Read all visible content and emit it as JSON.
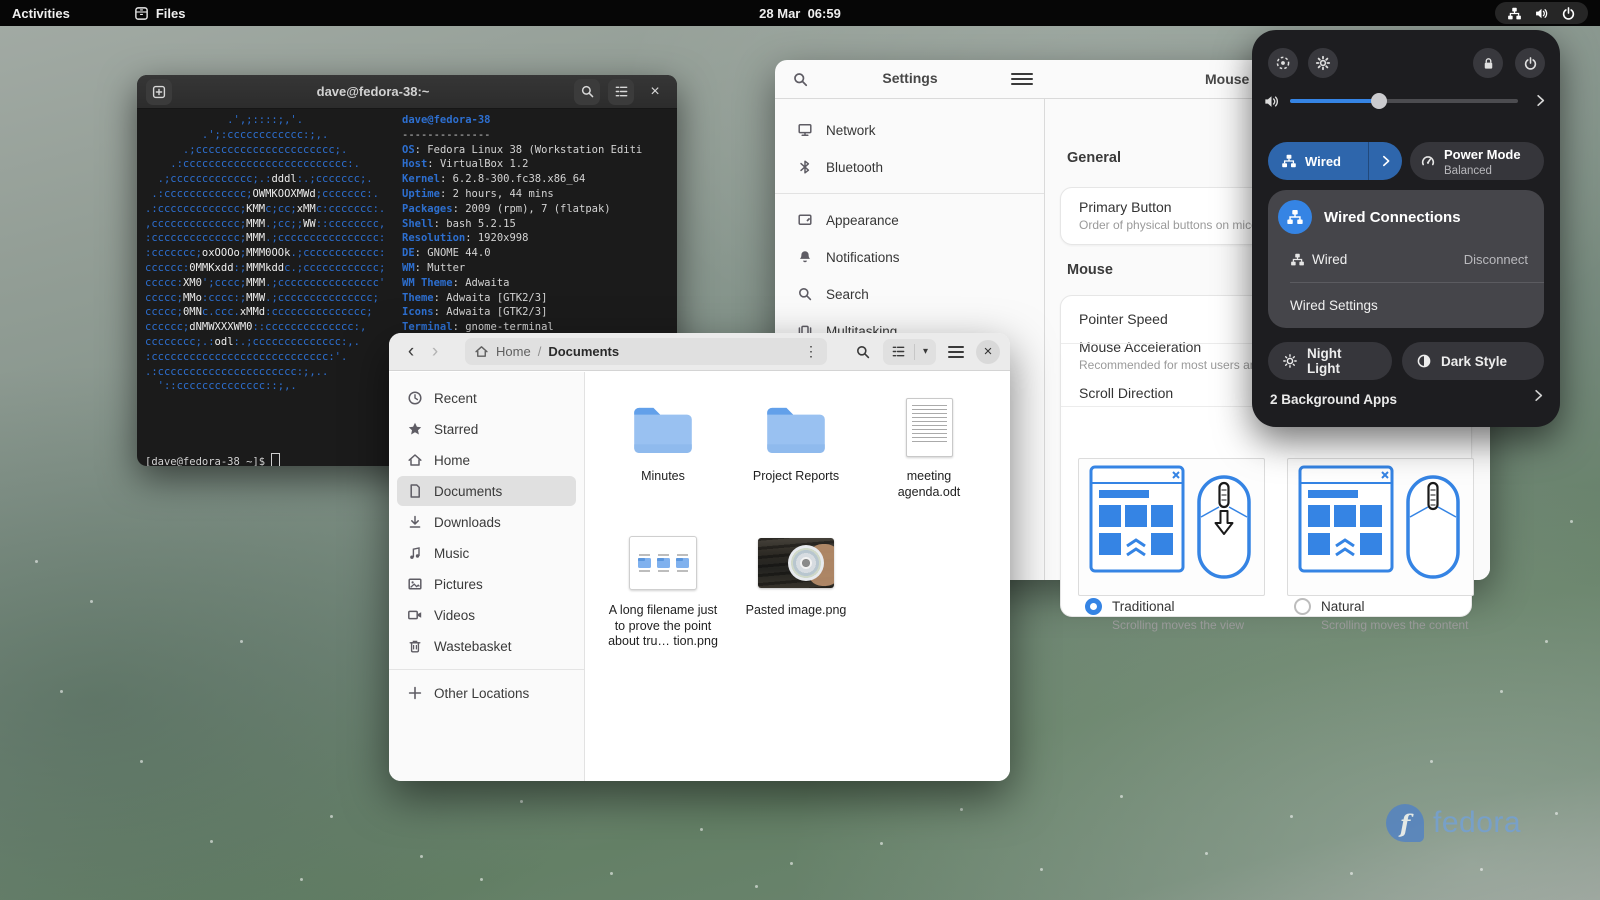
{
  "topbar": {
    "activities": "Activities",
    "files_label": "Files",
    "clock": "28 Mar  06:59"
  },
  "terminal": {
    "title": "dave@fedora-38:~",
    "user_host": "dave@fedora-38",
    "underline": "--------------",
    "ascii": "             .',;::::;,'.\n         .';:cccccccccccc:;,.\n      .;cccccccccccccccccccccc;.\n    .:cccccccccccccccccccccccccc:.\n  .;ccccccccccccc;.:dddl:.;ccccccc;.\n .:ccccccccccccc;OWMKOOXMWd;ccccccc:.\n.:ccccccccccccc;KMMc;cc;xMMc:ccccccc:.\n,cccccccccccccc;MMM.;cc;;WW::cccccccc,\n:cccccccccccccc;MMM.;cccccccccccccccc:\n:ccccccc;oxOOOo;MMM0OOk.;cccccccccccc:\ncccccc:0MMKxdd:;MMMkddc.;cccccccccccc;\nccccc:XM0';cccc;MMM.;cccccccccccccccc'\nccccc;MMo:cccc:;MMW.;ccccccccccccccc;\nccccc;0MNc.ccc.xMMd:ccccccccccccccc;\ncccccc;dNMWXXXWM0::cccccccccccccc:,\ncccccccc;.:odl:.;cccccccccccccc:,.\n:cccccccccccccccccccccccccccc:'.\n.:cccccccccccccccccccccc:;,..\n  '::cccccccccccccc::;,.",
    "info": [
      {
        "k": "OS",
        "v": ": Fedora Linux 38 (Workstation Editi"
      },
      {
        "k": "Host",
        "v": ": VirtualBox 1.2"
      },
      {
        "k": "Kernel",
        "v": ": 6.2.8-300.fc38.x86_64"
      },
      {
        "k": "Uptime",
        "v": ": 2 hours, 44 mins"
      },
      {
        "k": "Packages",
        "v": ": 2009 (rpm), 7 (flatpak)"
      },
      {
        "k": "Shell",
        "v": ": bash 5.2.15"
      },
      {
        "k": "Resolution",
        "v": ": 1920x998"
      },
      {
        "k": "DE",
        "v": ": GNOME 44.0"
      },
      {
        "k": "WM",
        "v": ": Mutter"
      },
      {
        "k": "WM Theme",
        "v": ": Adwaita"
      },
      {
        "k": "Theme",
        "v": ": Adwaita [GTK2/3]"
      },
      {
        "k": "Icons",
        "v": ": Adwaita [GTK2/3]"
      },
      {
        "k": "Terminal",
        "v": ": gnome-terminal"
      }
    ],
    "prompt": "[dave@fedora-38 ~]$"
  },
  "settings": {
    "title": "Settings",
    "page_title": "Mouse",
    "sidebar": [
      {
        "label": "Network"
      },
      {
        "label": "Bluetooth"
      },
      {
        "label": "Appearance"
      },
      {
        "label": "Notifications"
      },
      {
        "label": "Search"
      },
      {
        "label": "Multitasking"
      }
    ],
    "general_heading": "General",
    "primary": {
      "title": "Primary Button",
      "subtitle": "Order of physical buttons on mice and to"
    },
    "mouse_heading": "Mouse",
    "pointer_speed": "Pointer Speed",
    "accel": {
      "title": "Mouse Acceleration",
      "subtitle": "Recommended for most users and applic"
    },
    "scroll_direction": "Scroll Direction",
    "options": [
      {
        "label": "Traditional",
        "desc": "Scrolling moves the view",
        "selected": true
      },
      {
        "label": "Natural",
        "desc": "Scrolling moves the content",
        "selected": false
      }
    ]
  },
  "files": {
    "nav": {
      "home": "Home",
      "sep": "/",
      "current": "Documents"
    },
    "sidebar": [
      {
        "label": "Recent",
        "selected": false
      },
      {
        "label": "Starred",
        "selected": false
      },
      {
        "label": "Home",
        "selected": false
      },
      {
        "label": "Documents",
        "selected": true
      },
      {
        "label": "Downloads",
        "selected": false
      },
      {
        "label": "Music",
        "selected": false
      },
      {
        "label": "Pictures",
        "selected": false
      },
      {
        "label": "Videos",
        "selected": false
      },
      {
        "label": "Wastebasket",
        "selected": false
      },
      {
        "label": "Other Locations",
        "selected": false
      }
    ],
    "items": [
      {
        "name": "Minutes",
        "type": "folder"
      },
      {
        "name": "Project Reports",
        "type": "folder"
      },
      {
        "name": "meeting agenda.odt",
        "type": "document"
      },
      {
        "name": "A long filename just to prove the point about tru…  tion.png",
        "type": "image"
      },
      {
        "name": "Pasted image.png",
        "type": "image"
      }
    ]
  },
  "qs": {
    "volume": 39,
    "wired_label": "Wired",
    "power_mode": {
      "title": "Power Mode",
      "subtitle": "Balanced"
    },
    "menu": {
      "title": "Wired Connections",
      "row_label": "Wired",
      "action": "Disconnect",
      "settings_label": "Wired Settings"
    },
    "night_light": "Night Light",
    "dark_style": "Dark Style",
    "background_apps": "2 Background Apps"
  },
  "watermark": {
    "text": "fedora",
    "logo_letter": "f"
  },
  "colors": {
    "accent": "#3584e4",
    "terminal_blue": "#2d6fd0",
    "wired_tile": "#2e66ac"
  }
}
